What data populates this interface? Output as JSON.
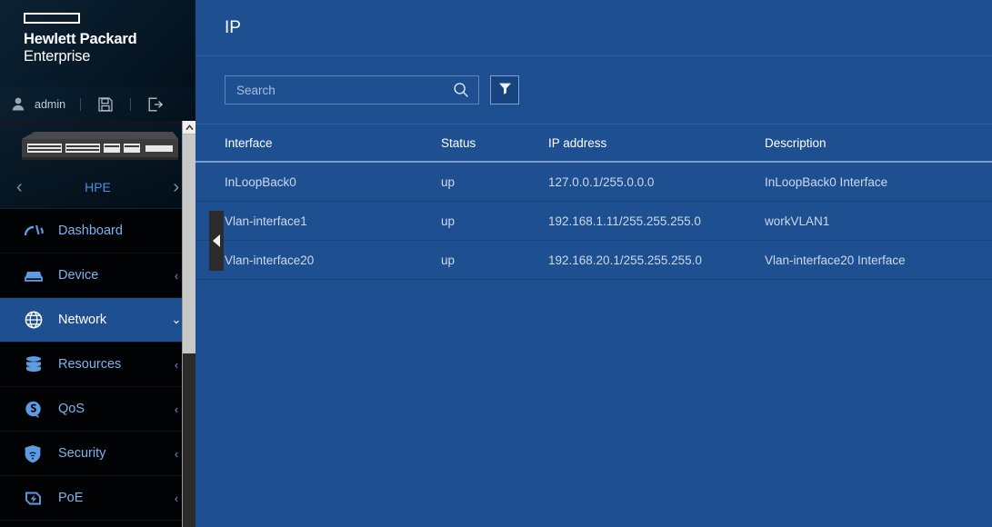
{
  "brand": {
    "line1": "Hewlett Packard",
    "line2": "Enterprise",
    "logo_icon": "hpe-logo-rectangle"
  },
  "userbar": {
    "user_icon": "user-icon",
    "username": "admin",
    "save_icon": "save-floppy-icon",
    "logout_icon": "logout-icon"
  },
  "device_panel": {
    "device_image_alt": "network-switch-front-panel",
    "prev_icon": "chevron-left-icon",
    "next_icon": "chevron-right-icon",
    "label": "HPE"
  },
  "sidebar": {
    "scroll_up_icon": "scroll-up-arrow-icon",
    "items": [
      {
        "label": "Dashboard",
        "icon": "dashboard-gauge-icon",
        "chevron": "",
        "active": false
      },
      {
        "label": "Device",
        "icon": "device-switch-icon",
        "chevron": "‹",
        "active": false
      },
      {
        "label": "Network",
        "icon": "globe-icon",
        "chevron": "⌄",
        "active": true
      },
      {
        "label": "Resources",
        "icon": "database-icon",
        "chevron": "‹",
        "active": false
      },
      {
        "label": "QoS",
        "icon": "qos-icon",
        "chevron": "‹",
        "active": false
      },
      {
        "label": "Security",
        "icon": "shield-icon",
        "chevron": "‹",
        "active": false
      },
      {
        "label": "PoE",
        "icon": "poe-bolt-shield-icon",
        "chevron": "‹",
        "active": false
      }
    ]
  },
  "collapse": {
    "icon": "collapse-left-triangle-icon"
  },
  "header": {
    "title": "IP"
  },
  "search": {
    "placeholder": "Search",
    "value": "",
    "search_icon": "search-magnifier-icon",
    "filter_icon": "filter-funnel-icon"
  },
  "table": {
    "columns": [
      "Interface",
      "Status",
      "IP address",
      "Description"
    ],
    "rows": [
      {
        "interface": "InLoopBack0",
        "status": "up",
        "ip": "127.0.0.1/255.0.0.0",
        "description": "InLoopBack0 Interface"
      },
      {
        "interface": "Vlan-interface1",
        "status": "up",
        "ip": "192.168.1.11/255.255.255.0",
        "description": "workVLAN1"
      },
      {
        "interface": "Vlan-interface20",
        "status": "up",
        "ip": "192.168.20.1/255.255.255.0",
        "description": "Vlan-interface20 Interface"
      }
    ]
  },
  "colors": {
    "content_blue": "#1d4f91",
    "sidebar_black": "#000204",
    "accent_link": "#7fb3ef",
    "header_navy": "#0a1c2b"
  }
}
